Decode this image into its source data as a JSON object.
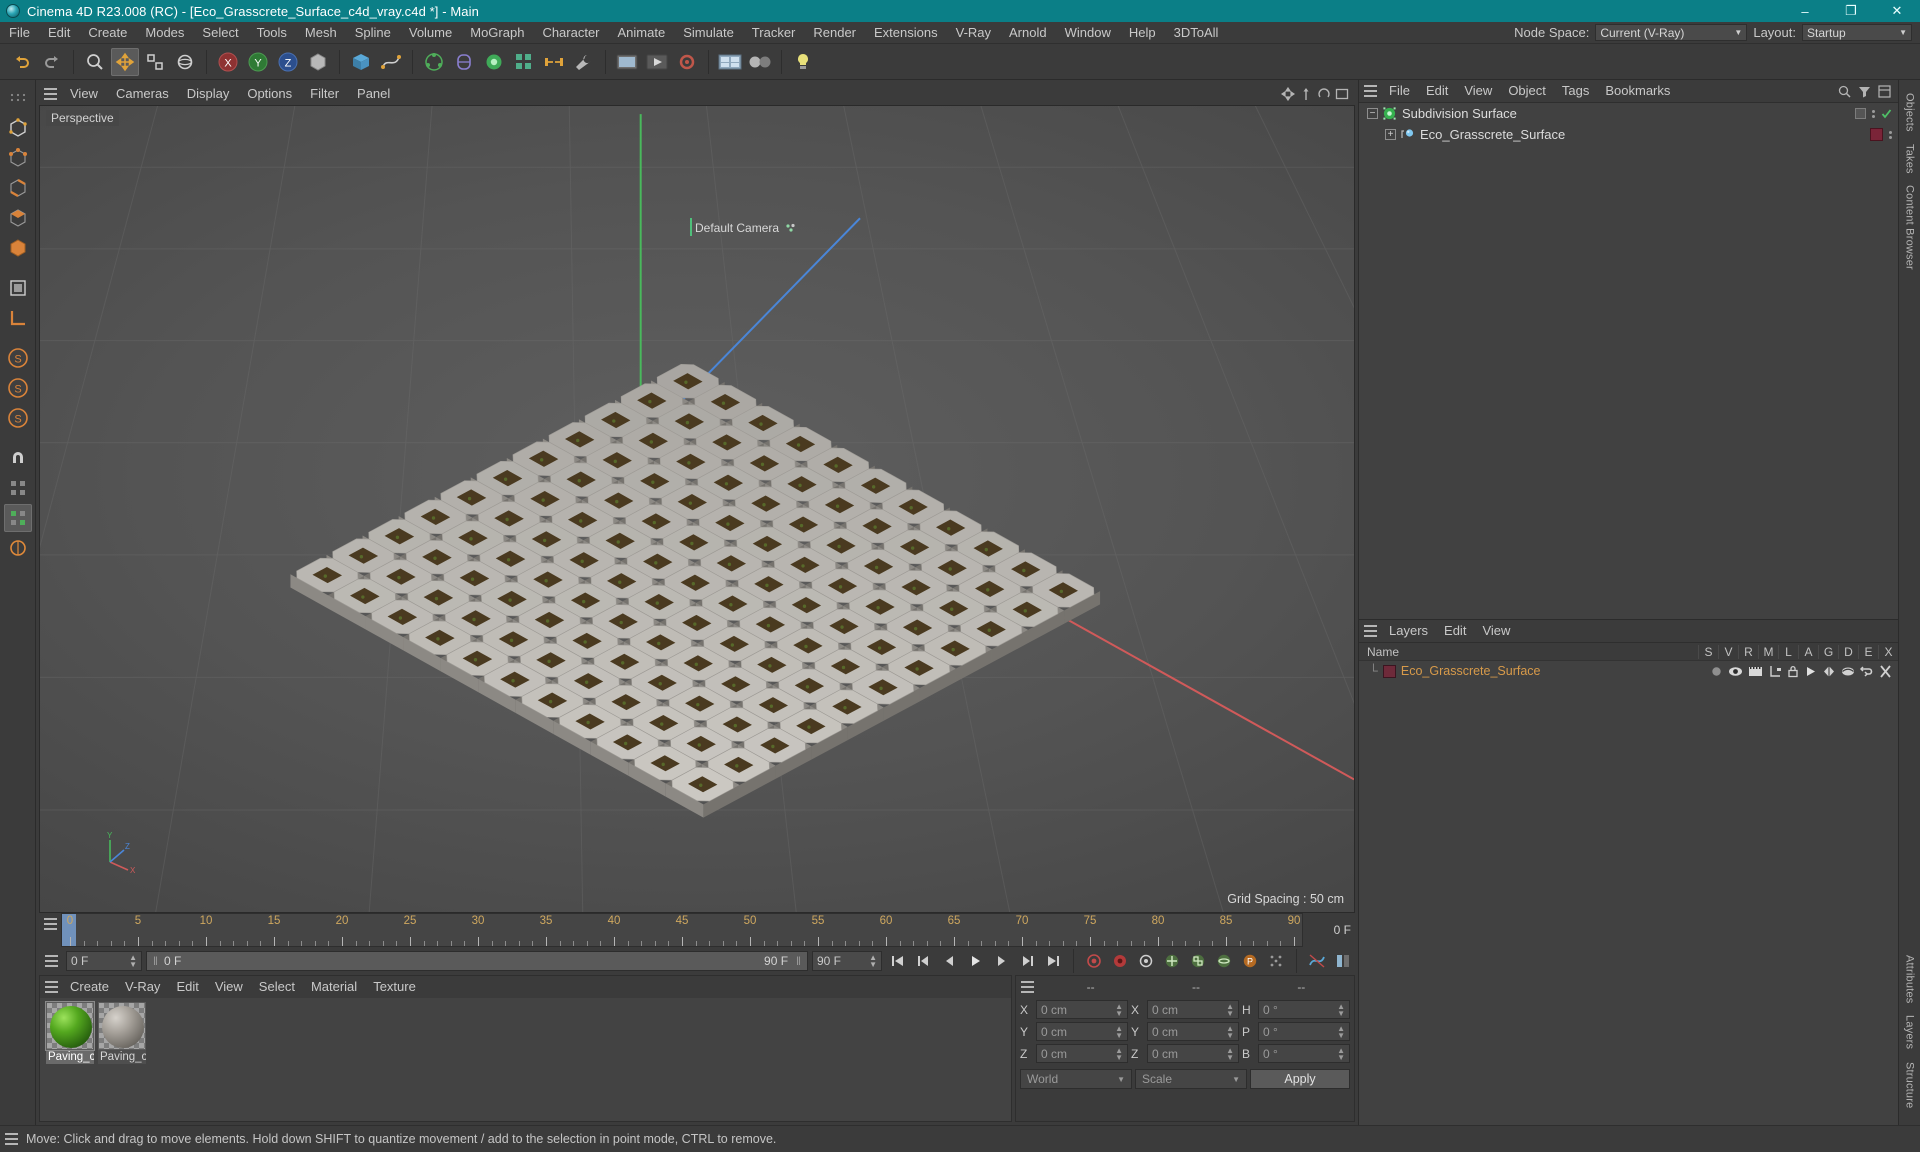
{
  "window": {
    "title": "Cinema 4D R23.008 (RC) - [Eco_Grasscrete_Surface_c4d_vray.c4d *] - Main",
    "minimize": "–",
    "maximize": "❐",
    "close": "✕"
  },
  "menubar": {
    "items": [
      "File",
      "Edit",
      "Create",
      "Modes",
      "Select",
      "Tools",
      "Mesh",
      "Spline",
      "Volume",
      "MoGraph",
      "Character",
      "Animate",
      "Simulate",
      "Tracker",
      "Render",
      "Extensions",
      "V-Ray",
      "Arnold",
      "Window",
      "Help",
      "3DToAll"
    ],
    "node_space_label": "Node Space:",
    "node_space_value": "Current (V-Ray)",
    "layout_label": "Layout:",
    "layout_value": "Startup"
  },
  "toolbar": {
    "icons": [
      "undo",
      "redo",
      "live-selection",
      "move",
      "scale",
      "rotate",
      "axis-lock-x",
      "axis-lock-y",
      "axis-lock-z",
      "world-object-coord",
      "cube-primitive",
      "spline-pen",
      "array-generator",
      "deformer-bend",
      "subdivision-surface",
      "mograph-cloner",
      "render-view",
      "render-region",
      "render-settings",
      "content-browser",
      "material-manager",
      "light"
    ]
  },
  "left_toolbar": {
    "icons": [
      "make-editable",
      "point-mode",
      "edge-mode",
      "polygon-mode",
      "model-mode",
      "object-mode",
      "texture-mode",
      "workplane-mode",
      "enable-axis",
      "enable-snap",
      "lock-x",
      "lock-y",
      "lock-z",
      "viewport-solo-off",
      "viewport-solo-single",
      "viewport-solo-hierarchy"
    ]
  },
  "viewport": {
    "menu": [
      "View",
      "Cameras",
      "Display",
      "Options",
      "Filter",
      "Panel"
    ],
    "perspective_label": "Perspective",
    "camera_label": "Default Camera",
    "grid_spacing": "Grid Spacing : 50 cm",
    "axis_labels": {
      "x": "X",
      "y": "Y",
      "z": "Z"
    }
  },
  "timeline": {
    "ticks": [
      0,
      5,
      10,
      15,
      20,
      25,
      30,
      35,
      40,
      45,
      50,
      55,
      60,
      65,
      70,
      75,
      80,
      85,
      90
    ],
    "current_frame": "0 F",
    "range_start": "0 F",
    "range_end": "90 F",
    "preview_end": "90 F",
    "slot_value": "0 F",
    "end_marker": "0 F",
    "transport_icons": [
      "go-to-start",
      "previous-key",
      "previous-frame",
      "play",
      "next-frame",
      "next-key",
      "go-to-end",
      "record",
      "autokey",
      "keyframe-selection",
      "position-key",
      "scale-key",
      "rotation-key",
      "parameter-key",
      "point-level-animation",
      "animation-mode",
      "timeline-settings"
    ]
  },
  "material_manager": {
    "menu": [
      "Create",
      "V-Ray",
      "Edit",
      "View",
      "Select",
      "Material",
      "Texture"
    ],
    "materials": [
      {
        "name": "Paving_c",
        "color": "#3c7a16",
        "selected": true
      },
      {
        "name": "Paving_c",
        "color": "#8e8a84",
        "selected": false
      }
    ]
  },
  "coordinates": {
    "header": [
      "--",
      "--",
      "--"
    ],
    "rows": [
      {
        "pos_label": "X",
        "pos_value": "0 cm",
        "size_label": "X",
        "size_value": "0 cm",
        "rot_label": "H",
        "rot_value": "0 °"
      },
      {
        "pos_label": "Y",
        "pos_value": "0 cm",
        "size_label": "Y",
        "size_value": "0 cm",
        "rot_label": "P",
        "rot_value": "0 °"
      },
      {
        "pos_label": "Z",
        "pos_value": "0 cm",
        "size_label": "Z",
        "size_value": "0 cm",
        "rot_label": "B",
        "rot_value": "0 °"
      }
    ],
    "coord_system": "World",
    "size_mode": "Scale",
    "apply_label": "Apply"
  },
  "object_manager": {
    "menu": [
      "File",
      "Edit",
      "View",
      "Object",
      "Tags",
      "Bookmarks"
    ],
    "search_icon": "search-icon",
    "objects": [
      {
        "name": "Subdivision Surface",
        "depth": 0,
        "icon": "subdivision-surface-icon",
        "expanded": true,
        "tag_color": "none"
      },
      {
        "name": "Eco_Grasscrete_Surface",
        "depth": 1,
        "icon": "polygon-object-icon",
        "expanded": false,
        "tag_color": "#7a2438"
      }
    ]
  },
  "layer_manager": {
    "menu": [
      "Layers",
      "Edit",
      "View"
    ],
    "columns": [
      "Name",
      "S",
      "V",
      "R",
      "M",
      "L",
      "A",
      "G",
      "D",
      "E",
      "X"
    ],
    "rows": [
      {
        "name": "Eco_Grasscrete_Surface",
        "color": "#7a2438"
      }
    ]
  },
  "right_tabs": [
    "Objects",
    "Takes",
    "Content Browser",
    "Attributes",
    "Layers",
    "Structure"
  ],
  "statusbar": {
    "message": "Move: Click and drag to move elements. Hold down SHIFT to quantize movement / add to the selection in point mode, CTRL to remove."
  },
  "colors": {
    "title_bar": "#0b7f87",
    "panel_bg": "#3b3b3b",
    "list_bg": "#414141",
    "layer_text": "#d79a4a",
    "axis_x": "#c84a4a",
    "axis_y": "#4fbf5a",
    "axis_z": "#4a7fc8"
  }
}
